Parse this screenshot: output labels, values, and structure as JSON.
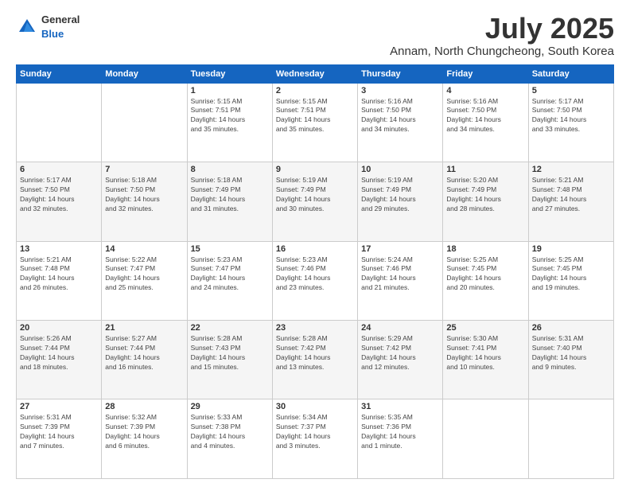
{
  "header": {
    "logo": {
      "general": "General",
      "blue": "Blue"
    },
    "title": "July 2025",
    "location": "Annam, North Chungcheong, South Korea"
  },
  "calendar": {
    "days_of_week": [
      "Sunday",
      "Monday",
      "Tuesday",
      "Wednesday",
      "Thursday",
      "Friday",
      "Saturday"
    ],
    "weeks": [
      [
        {
          "day": "",
          "info": ""
        },
        {
          "day": "",
          "info": ""
        },
        {
          "day": "1",
          "info": "Sunrise: 5:15 AM\nSunset: 7:51 PM\nDaylight: 14 hours\nand 35 minutes."
        },
        {
          "day": "2",
          "info": "Sunrise: 5:15 AM\nSunset: 7:51 PM\nDaylight: 14 hours\nand 35 minutes."
        },
        {
          "day": "3",
          "info": "Sunrise: 5:16 AM\nSunset: 7:50 PM\nDaylight: 14 hours\nand 34 minutes."
        },
        {
          "day": "4",
          "info": "Sunrise: 5:16 AM\nSunset: 7:50 PM\nDaylight: 14 hours\nand 34 minutes."
        },
        {
          "day": "5",
          "info": "Sunrise: 5:17 AM\nSunset: 7:50 PM\nDaylight: 14 hours\nand 33 minutes."
        }
      ],
      [
        {
          "day": "6",
          "info": "Sunrise: 5:17 AM\nSunset: 7:50 PM\nDaylight: 14 hours\nand 32 minutes."
        },
        {
          "day": "7",
          "info": "Sunrise: 5:18 AM\nSunset: 7:50 PM\nDaylight: 14 hours\nand 32 minutes."
        },
        {
          "day": "8",
          "info": "Sunrise: 5:18 AM\nSunset: 7:49 PM\nDaylight: 14 hours\nand 31 minutes."
        },
        {
          "day": "9",
          "info": "Sunrise: 5:19 AM\nSunset: 7:49 PM\nDaylight: 14 hours\nand 30 minutes."
        },
        {
          "day": "10",
          "info": "Sunrise: 5:19 AM\nSunset: 7:49 PM\nDaylight: 14 hours\nand 29 minutes."
        },
        {
          "day": "11",
          "info": "Sunrise: 5:20 AM\nSunset: 7:49 PM\nDaylight: 14 hours\nand 28 minutes."
        },
        {
          "day": "12",
          "info": "Sunrise: 5:21 AM\nSunset: 7:48 PM\nDaylight: 14 hours\nand 27 minutes."
        }
      ],
      [
        {
          "day": "13",
          "info": "Sunrise: 5:21 AM\nSunset: 7:48 PM\nDaylight: 14 hours\nand 26 minutes."
        },
        {
          "day": "14",
          "info": "Sunrise: 5:22 AM\nSunset: 7:47 PM\nDaylight: 14 hours\nand 25 minutes."
        },
        {
          "day": "15",
          "info": "Sunrise: 5:23 AM\nSunset: 7:47 PM\nDaylight: 14 hours\nand 24 minutes."
        },
        {
          "day": "16",
          "info": "Sunrise: 5:23 AM\nSunset: 7:46 PM\nDaylight: 14 hours\nand 23 minutes."
        },
        {
          "day": "17",
          "info": "Sunrise: 5:24 AM\nSunset: 7:46 PM\nDaylight: 14 hours\nand 21 minutes."
        },
        {
          "day": "18",
          "info": "Sunrise: 5:25 AM\nSunset: 7:45 PM\nDaylight: 14 hours\nand 20 minutes."
        },
        {
          "day": "19",
          "info": "Sunrise: 5:25 AM\nSunset: 7:45 PM\nDaylight: 14 hours\nand 19 minutes."
        }
      ],
      [
        {
          "day": "20",
          "info": "Sunrise: 5:26 AM\nSunset: 7:44 PM\nDaylight: 14 hours\nand 18 minutes."
        },
        {
          "day": "21",
          "info": "Sunrise: 5:27 AM\nSunset: 7:44 PM\nDaylight: 14 hours\nand 16 minutes."
        },
        {
          "day": "22",
          "info": "Sunrise: 5:28 AM\nSunset: 7:43 PM\nDaylight: 14 hours\nand 15 minutes."
        },
        {
          "day": "23",
          "info": "Sunrise: 5:28 AM\nSunset: 7:42 PM\nDaylight: 14 hours\nand 13 minutes."
        },
        {
          "day": "24",
          "info": "Sunrise: 5:29 AM\nSunset: 7:42 PM\nDaylight: 14 hours\nand 12 minutes."
        },
        {
          "day": "25",
          "info": "Sunrise: 5:30 AM\nSunset: 7:41 PM\nDaylight: 14 hours\nand 10 minutes."
        },
        {
          "day": "26",
          "info": "Sunrise: 5:31 AM\nSunset: 7:40 PM\nDaylight: 14 hours\nand 9 minutes."
        }
      ],
      [
        {
          "day": "27",
          "info": "Sunrise: 5:31 AM\nSunset: 7:39 PM\nDaylight: 14 hours\nand 7 minutes."
        },
        {
          "day": "28",
          "info": "Sunrise: 5:32 AM\nSunset: 7:39 PM\nDaylight: 14 hours\nand 6 minutes."
        },
        {
          "day": "29",
          "info": "Sunrise: 5:33 AM\nSunset: 7:38 PM\nDaylight: 14 hours\nand 4 minutes."
        },
        {
          "day": "30",
          "info": "Sunrise: 5:34 AM\nSunset: 7:37 PM\nDaylight: 14 hours\nand 3 minutes."
        },
        {
          "day": "31",
          "info": "Sunrise: 5:35 AM\nSunset: 7:36 PM\nDaylight: 14 hours\nand 1 minute."
        },
        {
          "day": "",
          "info": ""
        },
        {
          "day": "",
          "info": ""
        }
      ]
    ]
  }
}
